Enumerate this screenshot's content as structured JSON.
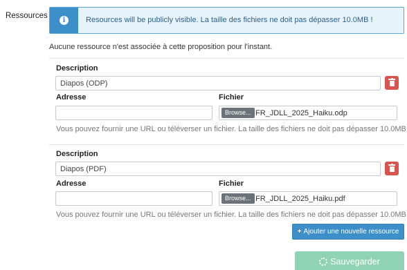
{
  "section": {
    "label": "Ressources"
  },
  "alert": {
    "icon": "info-icon",
    "message": "Resources will be publicly visible. La taille des fichiers ne doit pas dépasser 10.0MB !"
  },
  "empty_message": "Aucune ressource n'est associée à cette proposition pour l'instant.",
  "resources": [
    {
      "description_label": "Description",
      "description_value": "Diapos (ODP)",
      "address_label": "Adresse",
      "address_value": "",
      "file_label": "Fichier",
      "browse_label": "Browse...",
      "file_name": "FR_JDLL_2025_Haiku.odp",
      "help": "Vous pouvez fournir une URL ou téléverser un fichier. La taille des fichiers ne doit pas dépasser 10.0MB !"
    },
    {
      "description_label": "Description",
      "description_value": "Diapos (PDF)",
      "address_label": "Adresse",
      "address_value": "",
      "file_label": "Fichier",
      "browse_label": "Browse...",
      "file_name": "FR_JDLL_2025_Haiku.pdf",
      "help": "Vous pouvez fournir une URL ou téléverser un fichier. La taille des fichiers ne doit pas dépasser 10.0MB !"
    }
  ],
  "actions": {
    "add_label": "Ajouter une nouvelle ressource",
    "save_label": "Sauvegarder"
  },
  "colors": {
    "info": "#3d8fca",
    "danger": "#d9534f",
    "success_disabled": "#8fd3b4"
  }
}
